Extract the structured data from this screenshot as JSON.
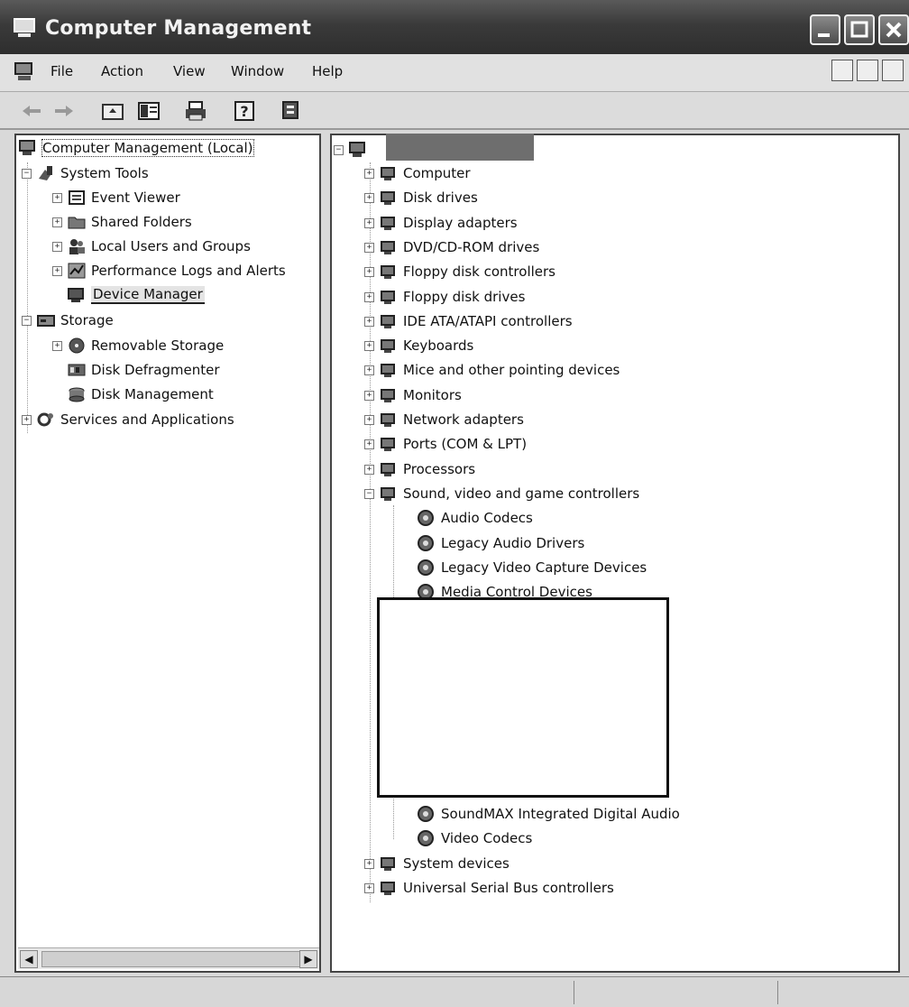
{
  "window": {
    "title": "Computer Management"
  },
  "menu": [
    "File",
    "Action",
    "View",
    "Window",
    "Help"
  ],
  "left_tree": [
    {
      "label": "Computer Management (Local)",
      "icon": "computer-management-icon"
    },
    {
      "label": "System Tools",
      "icon": "system-tools-icon"
    },
    {
      "label": "Event Viewer",
      "icon": "event-viewer-icon"
    },
    {
      "label": "Shared Folders",
      "icon": "shared-folders-icon"
    },
    {
      "label": "Local Users and Groups",
      "icon": "users-icon"
    },
    {
      "label": "Performance Logs and Alerts",
      "icon": "performance-icon"
    },
    {
      "label": "Device Manager",
      "icon": "device-manager-icon",
      "selected": true
    },
    {
      "label": "Storage",
      "icon": "storage-icon"
    },
    {
      "label": "Removable Storage",
      "icon": "removable-storage-icon"
    },
    {
      "label": "Disk Defragmenter",
      "icon": "defrag-icon"
    },
    {
      "label": "Disk Management",
      "icon": "disk-management-icon"
    },
    {
      "label": "Services and Applications",
      "icon": "services-icon"
    }
  ],
  "device_tree": {
    "categories": [
      "Computer",
      "Disk drives",
      "Display adapters",
      "DVD/CD-ROM drives",
      "Floppy disk controllers",
      "Floppy disk drives",
      "IDE ATA/ATAPI controllers",
      "Keyboards",
      "Mice and other pointing devices",
      "Monitors",
      "Network adapters",
      "Ports (COM & LPT)",
      "Processors",
      "Sound, video and game controllers"
    ],
    "sound_children_top": [
      "Audio Codecs",
      "Legacy Audio Drivers",
      "Legacy Video Capture Devices",
      "Media Control Devices"
    ],
    "sound_children_bottom": [
      "SoundMAX Integrated Digital Audio",
      "Video Codecs"
    ],
    "after": [
      "System devices",
      "Universal Serial Bus controllers"
    ]
  },
  "icons": {
    "back": "back-arrow-icon",
    "forward": "forward-arrow-icon",
    "up": "up-folder-icon",
    "show_hide": "show-hide-tree-icon",
    "print": "print-icon",
    "help": "help-icon",
    "properties": "properties-icon"
  }
}
